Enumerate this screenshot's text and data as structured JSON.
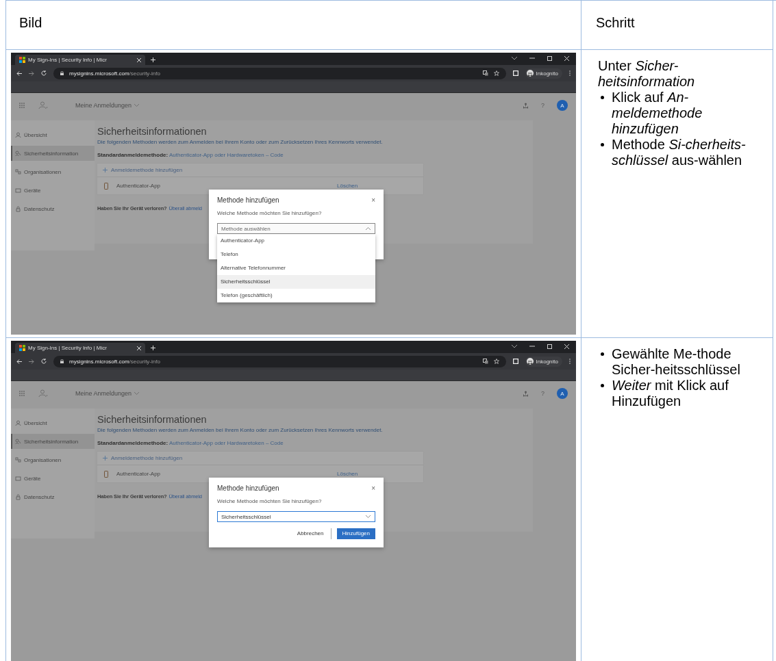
{
  "table": {
    "columns": [
      "Bild",
      "Schritt"
    ],
    "rows": [
      {
        "screenshot": {
          "browser": {
            "tab_title": "My Sign-Ins | Security Info | Micr",
            "url_host": "mysignins.microsoft.com",
            "url_path": "/security-info",
            "profile": "Inkognito"
          },
          "app": {
            "title": "Meine Anmeldungen",
            "help": "?",
            "avatar": "A"
          },
          "sidebar": [
            {
              "label": "Übersicht",
              "selected": false
            },
            {
              "label": "Sicherheitsinformation",
              "selected": true
            },
            {
              "label": "Organisationen",
              "selected": false
            },
            {
              "label": "Geräte",
              "selected": false
            },
            {
              "label": "Datenschutz",
              "selected": false
            }
          ],
          "page": {
            "heading": "Sicherheitsinformationen",
            "description": "Die folgenden Methoden werden zum Anmelden bei Ihrem Konto oder zum Zurücksetzen Ihres Kennworts verwendet.",
            "default_method": "**Standardanmeldemethode:** Authenticator-App oder Hardwaretoken – Code",
            "add_method": "Anmeldemethode hinzufügen",
            "methods": [
              {
                "name": "Authenticator-App",
                "action": "Löschen"
              }
            ],
            "lost_device": "Haben Sie Ihr Gerät verloren?",
            "lost_device_link": "Überall abmeld"
          },
          "dialog": {
            "title": "Methode hinzufügen",
            "close": "×",
            "prompt": "Welche Methode möchten Sie hinzufügen?",
            "select": {
              "placeholder": "Methode auswählen",
              "focused": false,
              "expanded": true
            },
            "options": [
              {
                "label": "Authenticator-App",
                "selected": false
              },
              {
                "label": "Telefon",
                "selected": false
              },
              {
                "label": "Alternative Telefonnummer",
                "selected": false
              },
              {
                "label": "Sicherheitsschlüssel",
                "selected": true
              },
              {
                "label": "Telefon (geschäftlich)",
                "selected": false
              }
            ]
          }
        },
        "steps": [
          {
            "kind": "plain",
            "text": "Unter *Sicher-heitsinformation*"
          },
          {
            "kind": "bullet",
            "text": "Klick auf *An-meldemethode hinzufügen*"
          },
          {
            "kind": "bullet",
            "text": "Methode *Si-cherheits-schlüssel* aus-wählen"
          }
        ]
      },
      {
        "screenshot": {
          "browser": {
            "tab_title": "My Sign-Ins | Security Info | Micr",
            "url_host": "mysignins.microsoft.com",
            "url_path": "/security-info",
            "profile": "Inkognito"
          },
          "app": {
            "title": "Meine Anmeldungen",
            "help": "?",
            "avatar": "A"
          },
          "sidebar": [
            {
              "label": "Übersicht",
              "selected": false
            },
            {
              "label": "Sicherheitsinformation",
              "selected": true
            },
            {
              "label": "Organisationen",
              "selected": false
            },
            {
              "label": "Geräte",
              "selected": false
            },
            {
              "label": "Datenschutz",
              "selected": false
            }
          ],
          "page": {
            "heading": "Sicherheitsinformationen",
            "description": "Die folgenden Methoden werden zum Anmelden bei Ihrem Konto oder zum Zurücksetzen Ihres Kennworts verwendet.",
            "default_method": "**Standardanmeldemethode:** Authenticator-App oder Hardwaretoken – Code",
            "add_method": "Anmeldemethode hinzufügen",
            "methods": [
              {
                "name": "Authenticator-App",
                "action": "Löschen"
              }
            ],
            "lost_device": "Haben Sie Ihr Gerät verloren?",
            "lost_device_link": "Überall abmeld"
          },
          "dialog": {
            "title": "Methode hinzufügen",
            "close": "×",
            "prompt": "Welche Methode möchten Sie hinzufügen?",
            "select": {
              "value": "Sicherheitsschlüssel",
              "focused": true,
              "expanded": false
            },
            "buttons": [
              {
                "label": "Abbrechen",
                "kind": "secondary"
              },
              {
                "label": "Hinzufügen",
                "kind": "primary"
              }
            ]
          }
        },
        "steps": [
          {
            "kind": "bullet",
            "text": "Gewählte Me-thode Sicher-heitsschlüssel"
          },
          {
            "kind": "bullet",
            "text": "*Weiter* mit Klick auf Hinzufügen"
          }
        ]
      }
    ]
  }
}
